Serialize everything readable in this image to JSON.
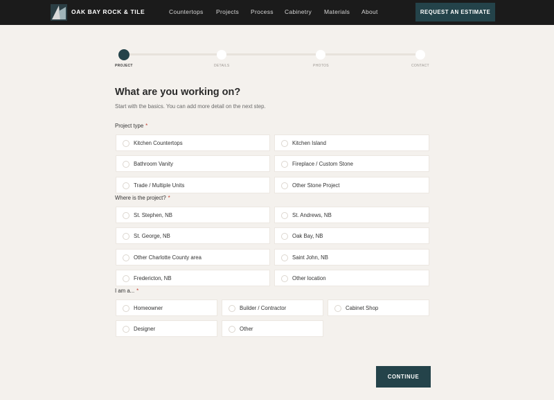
{
  "header": {
    "brand": "OAK BAY ROCK & TILE",
    "nav": [
      "Countertops",
      "Projects",
      "Process",
      "Cabinetry",
      "Materials",
      "About"
    ],
    "cta": "REQUEST AN ESTIMATE"
  },
  "stepper": {
    "steps": [
      "PROJECT",
      "DETAILS",
      "PHOTOS",
      "CONTACT"
    ],
    "active_index": 0
  },
  "form": {
    "title": "What are you working on?",
    "subtitle": "Start with the basics. You can add more detail on the next step.",
    "required_marker": "*",
    "project_type": {
      "label": "Project type",
      "options": [
        "Kitchen Countertops",
        "Kitchen Island",
        "Bathroom Vanity",
        "Fireplace / Custom Stone",
        "Trade / Multiple Units",
        "Other Stone Project"
      ]
    },
    "location": {
      "label": "Where is the project?",
      "options": [
        "St. Stephen, NB",
        "St. Andrews, NB",
        "St. George, NB",
        "Oak Bay, NB",
        "Other Charlotte County area",
        "Saint John, NB",
        "Fredericton, NB",
        "Other location"
      ]
    },
    "role": {
      "label": "I am a...",
      "options": [
        "Homeowner",
        "Builder / Contractor",
        "Cabinet Shop",
        "Designer",
        "Other"
      ]
    },
    "continue": "CONTINUE"
  },
  "colors": {
    "accent": "#24434a",
    "background": "#f4f1ed",
    "header": "#1b1b1b",
    "required": "#c0392b"
  }
}
